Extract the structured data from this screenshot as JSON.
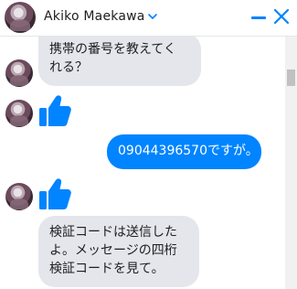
{
  "contact": {
    "name": "Akiko Maekawa"
  },
  "icons": {
    "dropdown": "chevron-down-icon",
    "minimize": "minimize-icon",
    "close": "close-icon",
    "like": "thumbs-up-icon"
  },
  "colors": {
    "accent": "#0084ff",
    "incoming_bubble": "#e4e6eb",
    "text": "#1c1e21"
  },
  "messages": [
    {
      "from": "contact",
      "type": "text",
      "text": "携帯の番号を教えてく\nれる？"
    },
    {
      "from": "contact",
      "type": "like"
    },
    {
      "from": "me",
      "type": "text",
      "text": "09044396570ですが。"
    },
    {
      "from": "contact",
      "type": "like"
    },
    {
      "from": "contact",
      "type": "text",
      "text": "検証コードは送信した\nよ。メッセージの四桁\n検証コードを見て。"
    }
  ]
}
